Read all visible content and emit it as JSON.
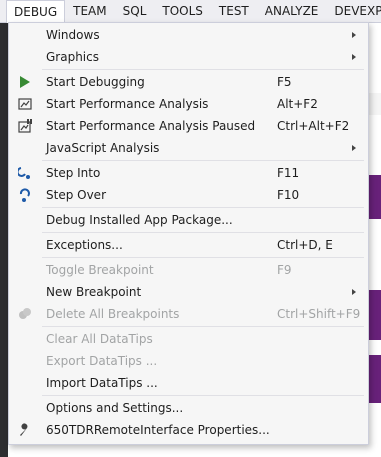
{
  "menubar": [
    "DEBUG",
    "TEAM",
    "SQL",
    "TOOLS",
    "TEST",
    "ANALYZE",
    "DEVEXP"
  ],
  "menu": {
    "windows": "Windows",
    "graphics": "Graphics",
    "start_debugging": {
      "label": "Start Debugging",
      "shortcut": "F5"
    },
    "start_perf": {
      "label": "Start Performance Analysis",
      "shortcut": "Alt+F2"
    },
    "start_perf_paused": {
      "label": "Start Performance Analysis Paused",
      "shortcut": "Ctrl+Alt+F2"
    },
    "js_analysis": "JavaScript Analysis",
    "step_into": {
      "label": "Step Into",
      "shortcut": "F11"
    },
    "step_over": {
      "label": "Step Over",
      "shortcut": "F10"
    },
    "debug_installed": "Debug Installed App Package...",
    "exceptions": {
      "label": "Exceptions...",
      "shortcut": "Ctrl+D, E"
    },
    "toggle_breakpoint": {
      "label": "Toggle Breakpoint",
      "shortcut": "F9"
    },
    "new_breakpoint": "New Breakpoint",
    "delete_breakpoints": {
      "label": "Delete All Breakpoints",
      "shortcut": "Ctrl+Shift+F9"
    },
    "clear_datatips": "Clear All DataTips",
    "export_datatips": "Export DataTips ...",
    "import_datatips": "Import DataTips ...",
    "options": "Options and Settings...",
    "properties": "650TDRRemoteInterface Properties..."
  },
  "colors": {
    "play_green": "#388a34",
    "step_blue": "#1e5aa8",
    "disabled_text": "#a2a4a5",
    "background_purple": "#68217a"
  }
}
